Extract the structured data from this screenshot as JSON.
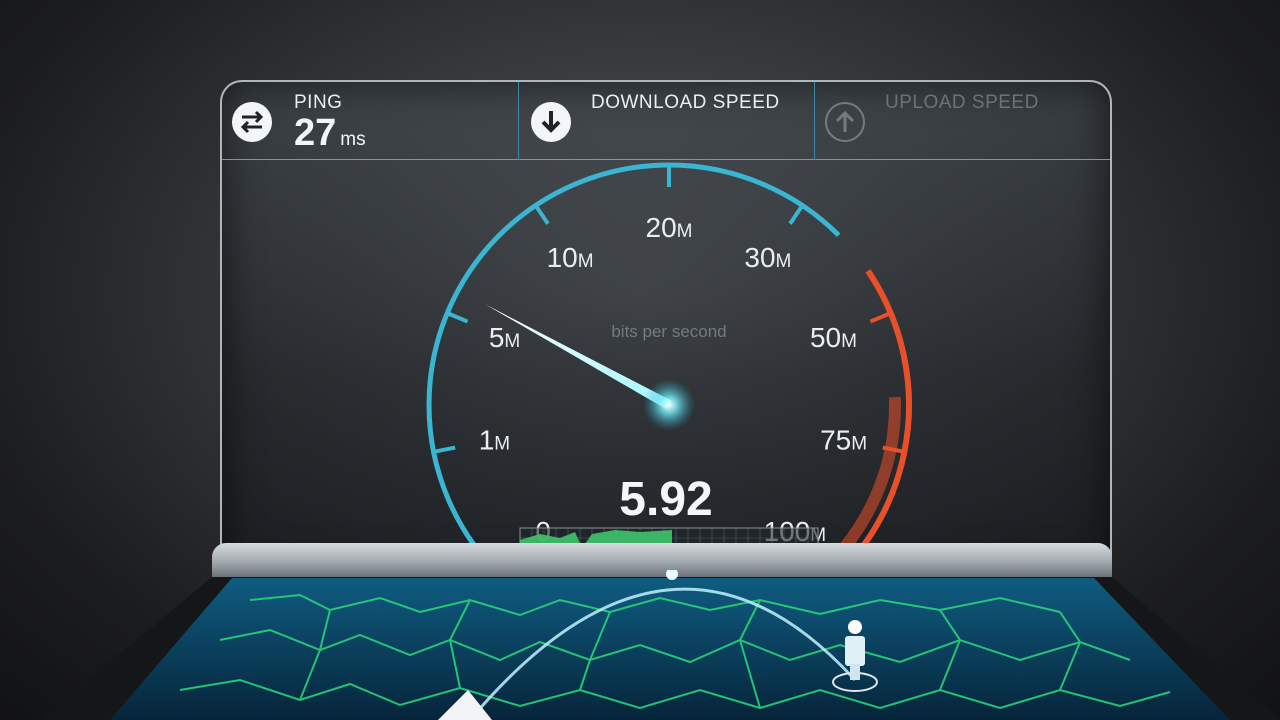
{
  "header": {
    "ping": {
      "label": "PING",
      "value": "27",
      "unit": "ms",
      "icon": "swap-arrows-icon"
    },
    "download": {
      "label": "DOWNLOAD SPEED",
      "icon": "download-arrow-icon"
    },
    "upload": {
      "label": "UPLOAD SPEED",
      "icon": "upload-arrow-icon"
    }
  },
  "gauge": {
    "ticks": [
      {
        "label": "0",
        "unit": ""
      },
      {
        "label": "1",
        "unit": "M"
      },
      {
        "label": "5",
        "unit": "M"
      },
      {
        "label": "10",
        "unit": "M"
      },
      {
        "label": "20",
        "unit": "M"
      },
      {
        "label": "30",
        "unit": "M"
      },
      {
        "label": "50",
        "unit": "M"
      },
      {
        "label": "75",
        "unit": "M"
      },
      {
        "label": "100",
        "unit": "M"
      }
    ],
    "caption": "bits per second",
    "reading": "5.92",
    "colors": {
      "normal": "#3ab6d2",
      "high": "#e8502a",
      "graph": "#3ec46a"
    }
  }
}
